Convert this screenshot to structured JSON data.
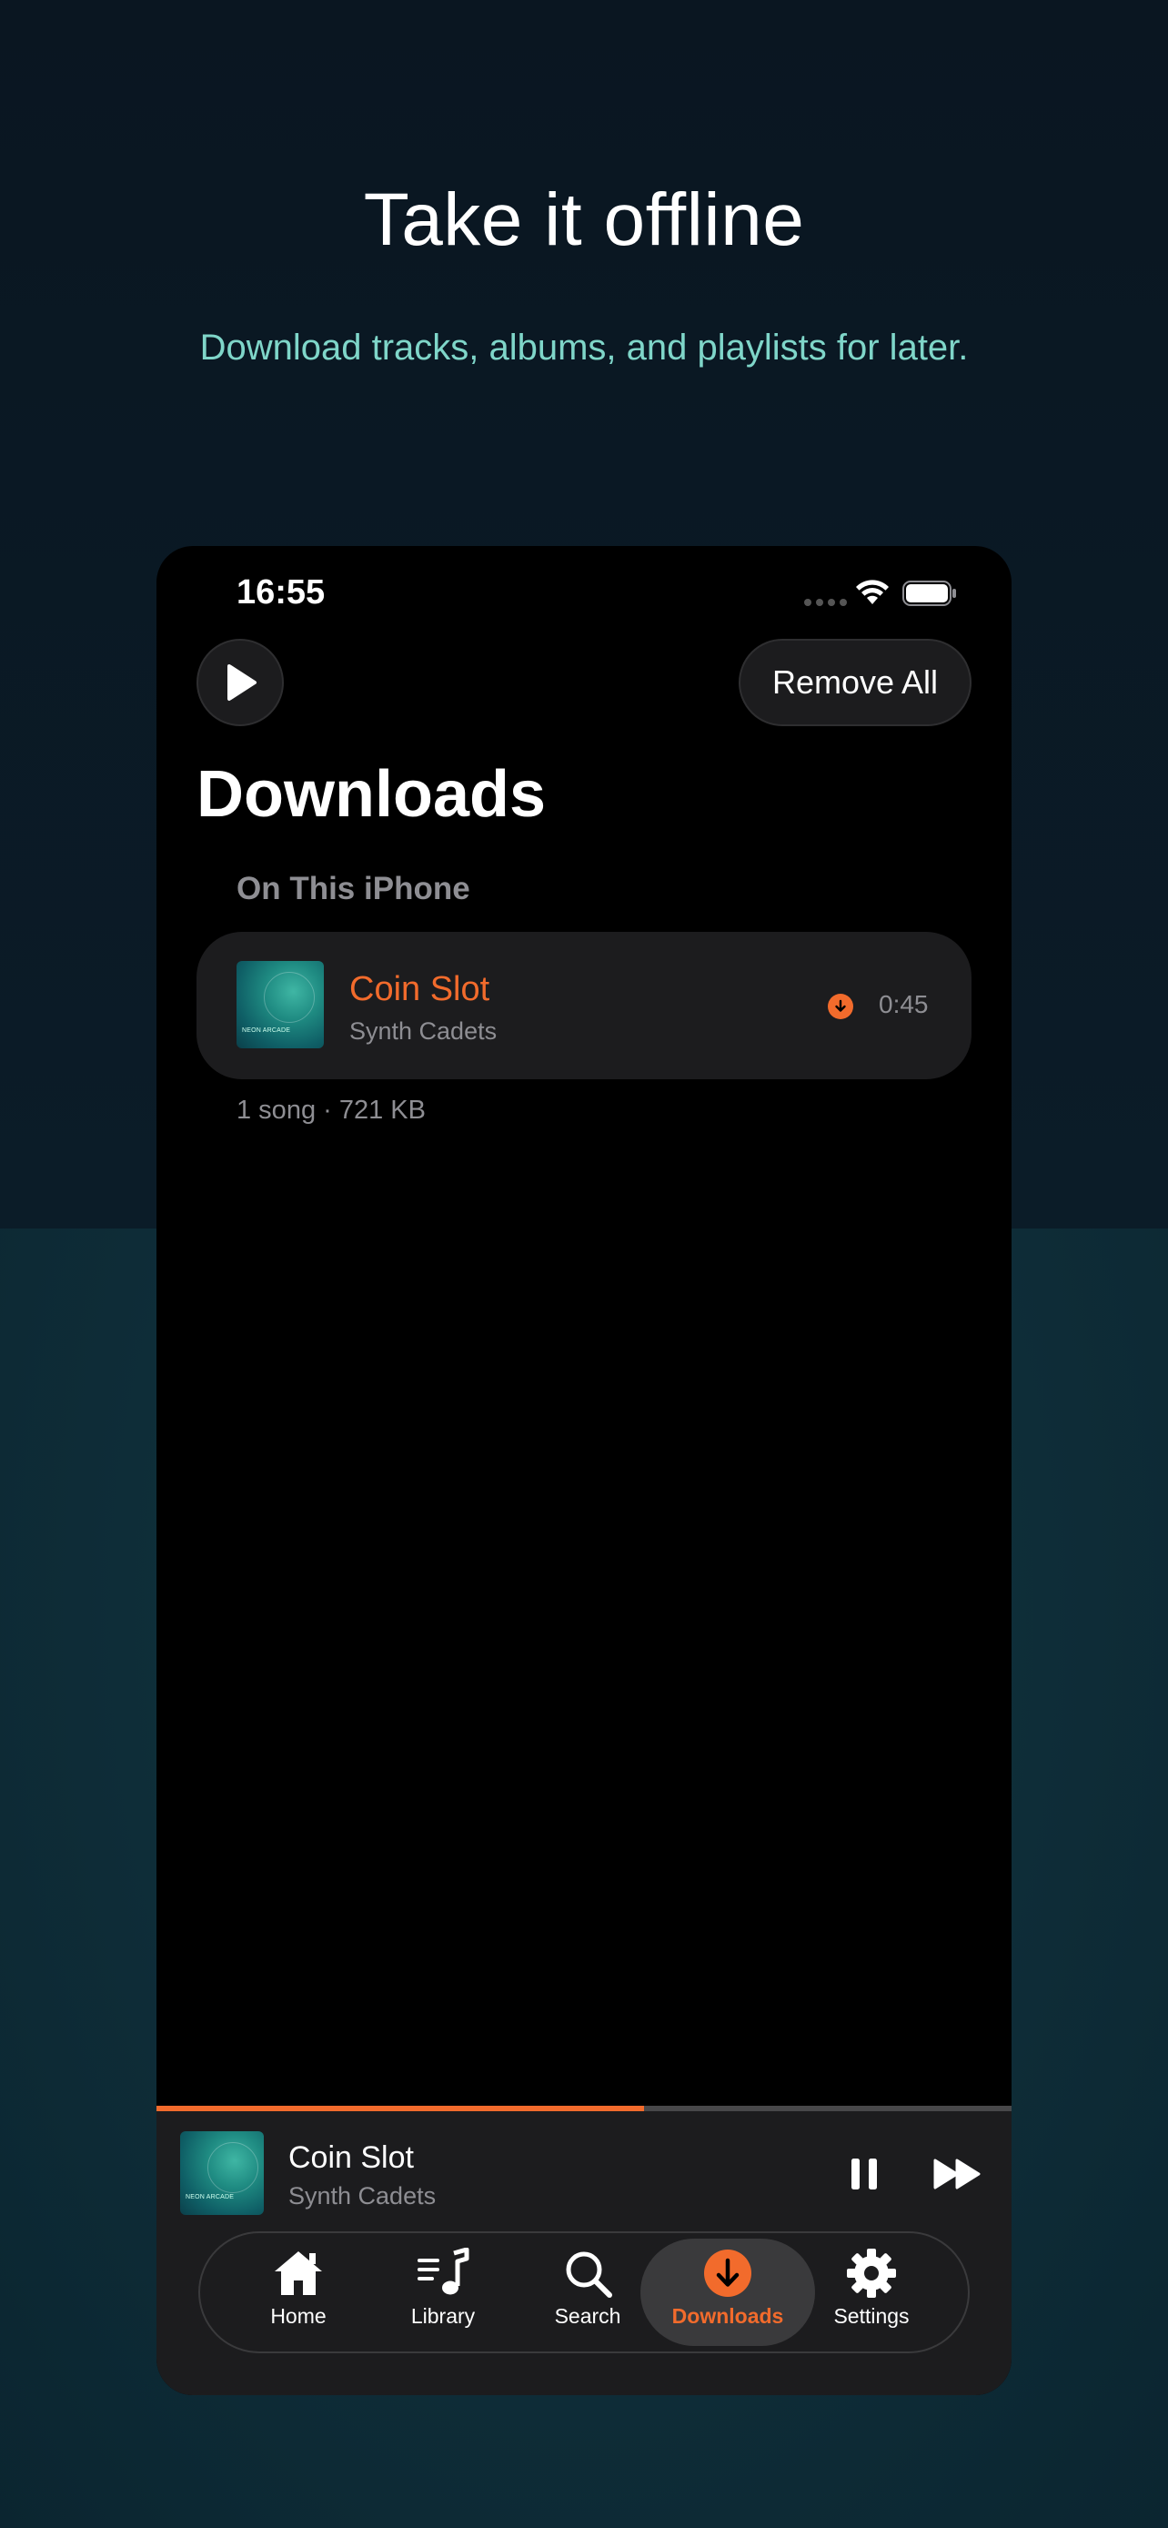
{
  "promo": {
    "headline": "Take it offline",
    "subline": "Download tracks, albums, and playlists for later."
  },
  "status_bar": {
    "time": "16:55"
  },
  "header": {
    "play_icon": "play-icon",
    "remove_all_label": "Remove All"
  },
  "page": {
    "title": "Downloads",
    "section_label": "On This iPhone",
    "summary": "1 song · 721 KB"
  },
  "tracks": [
    {
      "title": "Coin Slot",
      "artist": "Synth Cadets",
      "duration": "0:45",
      "artwork_text": "NEON ARCADE",
      "downloaded": true
    }
  ],
  "now_playing": {
    "title": "Coin Slot",
    "artist": "Synth Cadets",
    "artwork_text": "NEON ARCADE",
    "progress": 0.57,
    "state": "playing"
  },
  "tabbar": {
    "tabs": [
      {
        "label": "Home",
        "icon": "home-icon",
        "active": false
      },
      {
        "label": "Library",
        "icon": "library-icon",
        "active": false
      },
      {
        "label": "Search",
        "icon": "search-icon",
        "active": false
      },
      {
        "label": "Downloads",
        "icon": "download-icon",
        "active": true
      },
      {
        "label": "Settings",
        "icon": "gear-icon",
        "active": false
      }
    ]
  },
  "colors": {
    "accent": "#f26b2c",
    "subline": "#7fd6c9",
    "card": "#1c1c1e",
    "muted_text": "#8e8e93"
  }
}
